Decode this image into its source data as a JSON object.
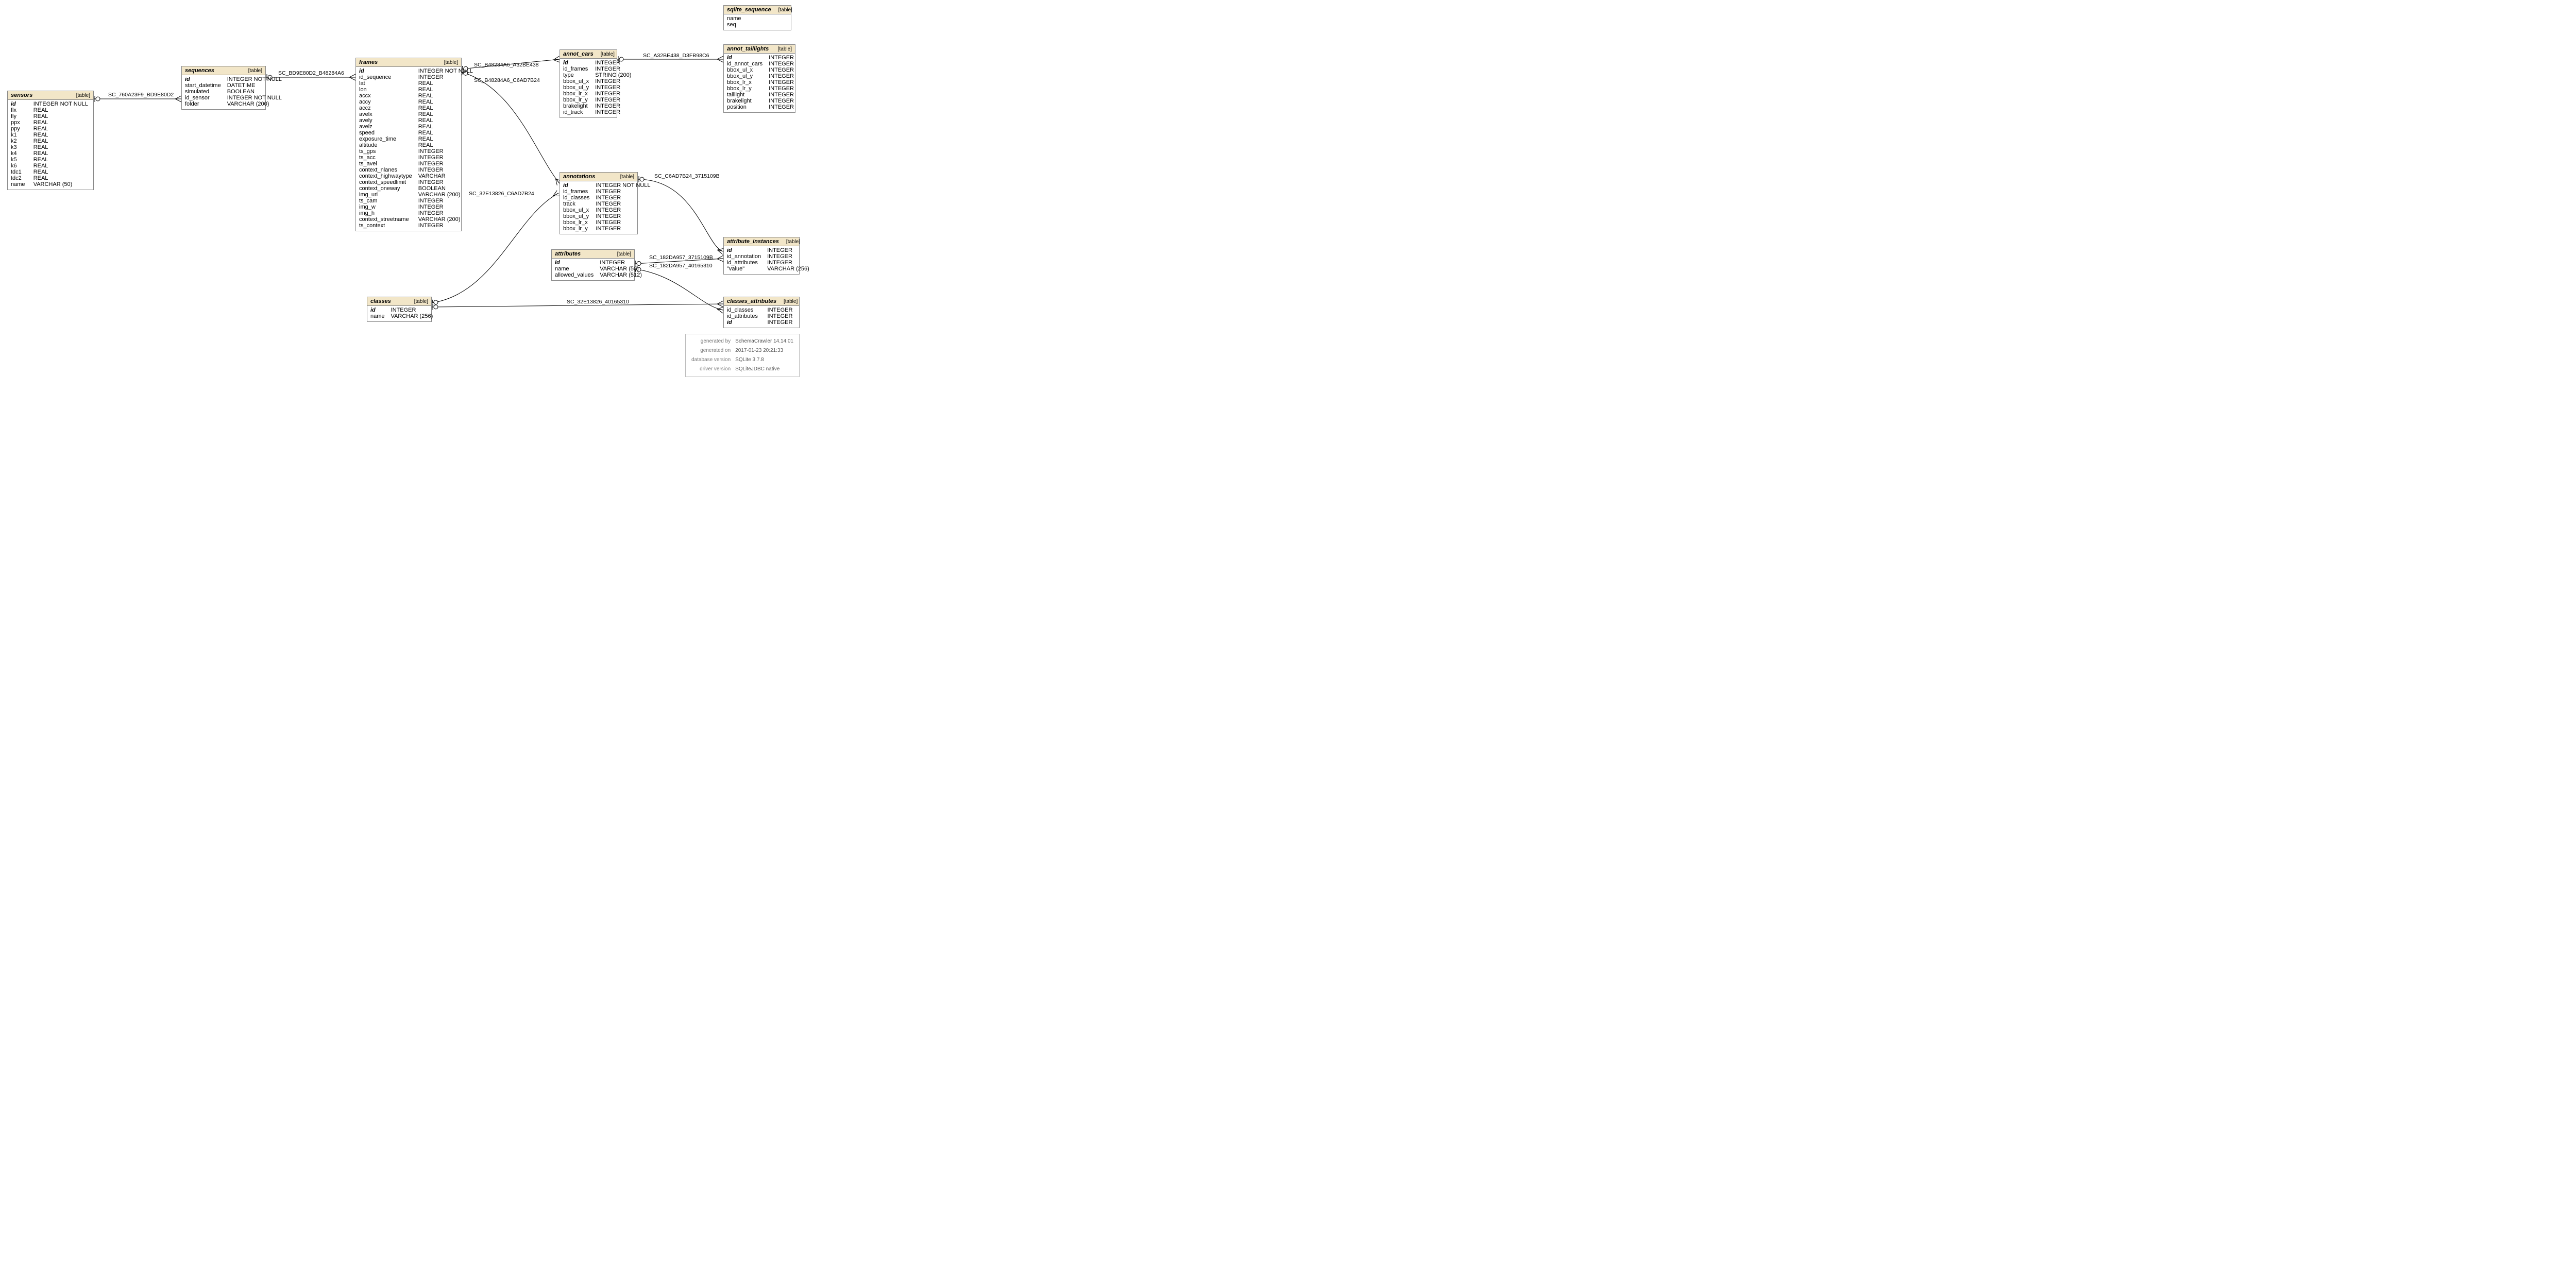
{
  "type_label": "[table]",
  "tables": {
    "sensors": {
      "name": "sensors",
      "cols": [
        {
          "n": "id",
          "t": "INTEGER NOT NULL",
          "pk": true
        },
        {
          "n": "flx",
          "t": "REAL"
        },
        {
          "n": "fly",
          "t": "REAL"
        },
        {
          "n": "ppx",
          "t": "REAL"
        },
        {
          "n": "ppy",
          "t": "REAL"
        },
        {
          "n": "k1",
          "t": "REAL"
        },
        {
          "n": "k2",
          "t": "REAL"
        },
        {
          "n": "k3",
          "t": "REAL"
        },
        {
          "n": "k4",
          "t": "REAL"
        },
        {
          "n": "k5",
          "t": "REAL"
        },
        {
          "n": "k6",
          "t": "REAL"
        },
        {
          "n": "tdc1",
          "t": "REAL"
        },
        {
          "n": "tdc2",
          "t": "REAL"
        },
        {
          "n": "name",
          "t": "VARCHAR (50)"
        }
      ]
    },
    "sequences": {
      "name": "sequences",
      "cols": [
        {
          "n": "id",
          "t": "INTEGER NOT NULL",
          "pk": true
        },
        {
          "n": "start_datetime",
          "t": "DATETIME"
        },
        {
          "n": "simulated",
          "t": "BOOLEAN"
        },
        {
          "n": "id_sensor",
          "t": "INTEGER NOT NULL"
        },
        {
          "n": "folder",
          "t": "VARCHAR (200)"
        }
      ]
    },
    "frames": {
      "name": "frames",
      "cols": [
        {
          "n": "id",
          "t": "INTEGER NOT NULL",
          "pk": true
        },
        {
          "n": "id_sequence",
          "t": "INTEGER"
        },
        {
          "n": "lat",
          "t": "REAL"
        },
        {
          "n": "lon",
          "t": "REAL"
        },
        {
          "n": "accx",
          "t": "REAL"
        },
        {
          "n": "accy",
          "t": "REAL"
        },
        {
          "n": "accz",
          "t": "REAL"
        },
        {
          "n": "avelx",
          "t": "REAL"
        },
        {
          "n": "avely",
          "t": "REAL"
        },
        {
          "n": "avelz",
          "t": "REAL"
        },
        {
          "n": "speed",
          "t": "REAL"
        },
        {
          "n": "exposure_time",
          "t": "REAL"
        },
        {
          "n": "altitude",
          "t": "REAL"
        },
        {
          "n": "ts_gps",
          "t": "INTEGER"
        },
        {
          "n": "ts_acc",
          "t": "INTEGER"
        },
        {
          "n": "ts_avel",
          "t": "INTEGER"
        },
        {
          "n": "context_nlanes",
          "t": "INTEGER"
        },
        {
          "n": "context_highwaytype",
          "t": "VARCHAR"
        },
        {
          "n": "context_speedlimit",
          "t": "INTEGER"
        },
        {
          "n": "context_oneway",
          "t": "BOOLEAN"
        },
        {
          "n": "img_uri",
          "t": "VARCHAR (200)"
        },
        {
          "n": "ts_cam",
          "t": "INTEGER"
        },
        {
          "n": "img_w",
          "t": "INTEGER"
        },
        {
          "n": "img_h",
          "t": "INTEGER"
        },
        {
          "n": "context_streetname",
          "t": "VARCHAR (200)"
        },
        {
          "n": "ts_context",
          "t": "INTEGER"
        }
      ]
    },
    "annot_cars": {
      "name": "annot_cars",
      "cols": [
        {
          "n": "id",
          "t": "INTEGER",
          "pk": true
        },
        {
          "n": "id_frames",
          "t": "INTEGER"
        },
        {
          "n": "type",
          "t": "STRING (200)"
        },
        {
          "n": "bbox_ul_x",
          "t": "INTEGER"
        },
        {
          "n": "bbox_ul_y",
          "t": "INTEGER"
        },
        {
          "n": "bbox_lr_x",
          "t": "INTEGER"
        },
        {
          "n": "bbox_lr_y",
          "t": "INTEGER"
        },
        {
          "n": "brakelight",
          "t": "INTEGER"
        },
        {
          "n": "id_track",
          "t": "INTEGER"
        }
      ]
    },
    "annot_taillights": {
      "name": "annot_taillights",
      "cols": [
        {
          "n": "id",
          "t": "INTEGER",
          "pk": true
        },
        {
          "n": "id_annot_cars",
          "t": "INTEGER"
        },
        {
          "n": "bbox_ul_x",
          "t": "INTEGER"
        },
        {
          "n": "bbox_ul_y",
          "t": "INTEGER"
        },
        {
          "n": "bbox_lr_x",
          "t": "INTEGER"
        },
        {
          "n": "bbox_lr_y",
          "t": "INTEGER"
        },
        {
          "n": "taillight",
          "t": "INTEGER"
        },
        {
          "n": "brakelight",
          "t": "INTEGER"
        },
        {
          "n": "position",
          "t": "INTEGER"
        }
      ]
    },
    "sqlite_sequence": {
      "name": "sqlite_sequence",
      "cols": [
        {
          "n": "name",
          "t": ""
        },
        {
          "n": "seq",
          "t": ""
        }
      ]
    },
    "annotations": {
      "name": "annotations",
      "cols": [
        {
          "n": "id",
          "t": "INTEGER NOT NULL",
          "pk": true
        },
        {
          "n": "id_frames",
          "t": "INTEGER"
        },
        {
          "n": "id_classes",
          "t": "INTEGER"
        },
        {
          "n": "track",
          "t": "INTEGER"
        },
        {
          "n": "bbox_ul_x",
          "t": "INTEGER"
        },
        {
          "n": "bbox_ul_y",
          "t": "INTEGER"
        },
        {
          "n": "bbox_lr_x",
          "t": "INTEGER"
        },
        {
          "n": "bbox_lr_y",
          "t": "INTEGER"
        }
      ]
    },
    "attributes": {
      "name": "attributes",
      "cols": [
        {
          "n": "id",
          "t": "INTEGER",
          "pk": true
        },
        {
          "n": "name",
          "t": "VARCHAR (50)"
        },
        {
          "n": "allowed_values",
          "t": "VARCHAR (512)"
        }
      ]
    },
    "attribute_instances": {
      "name": "attribute_instances",
      "cols": [
        {
          "n": "id",
          "t": "INTEGER",
          "pk": true
        },
        {
          "n": "id_annotation",
          "t": "INTEGER"
        },
        {
          "n": "id_attributes",
          "t": "INTEGER"
        },
        {
          "n": "\"value\"",
          "t": "VARCHAR (256)"
        }
      ]
    },
    "classes": {
      "name": "classes",
      "cols": [
        {
          "n": "id",
          "t": "INTEGER",
          "pk": true
        },
        {
          "n": "name",
          "t": "VARCHAR (256)"
        }
      ]
    },
    "classes_attributes": {
      "name": "classes_attributes",
      "cols": [
        {
          "n": "id_classes",
          "t": "INTEGER"
        },
        {
          "n": "id_attributes",
          "t": "INTEGER"
        },
        {
          "n": "id",
          "t": "INTEGER",
          "pk": true
        }
      ]
    }
  },
  "edges": {
    "e1": "SC_760A23F9_BD9E80D2",
    "e2": "SC_BD9E80D2_B48284A6",
    "e3": "SC_B48284A6_A32BE438",
    "e4": "SC_B48284A6_C6AD7B24",
    "e5": "SC_A32BE438_D3FB98C6",
    "e6": "SC_C6AD7B24_3715109B",
    "e7": "SC_32E13826_C6AD7B24",
    "e8": "SC_182DA957_3715109B",
    "e9": "SC_182DA957_40165310",
    "e10": "SC_32E13826_40165310"
  },
  "meta": {
    "r1k": "generated by",
    "r1v": "SchemaCrawler 14.14.01",
    "r2k": "generated on",
    "r2v": "2017-01-23 20:21:33",
    "r3k": "database version",
    "r3v": "SQLite 3.7.8",
    "r4k": "driver version",
    "r4v": "SQLiteJDBC native"
  }
}
